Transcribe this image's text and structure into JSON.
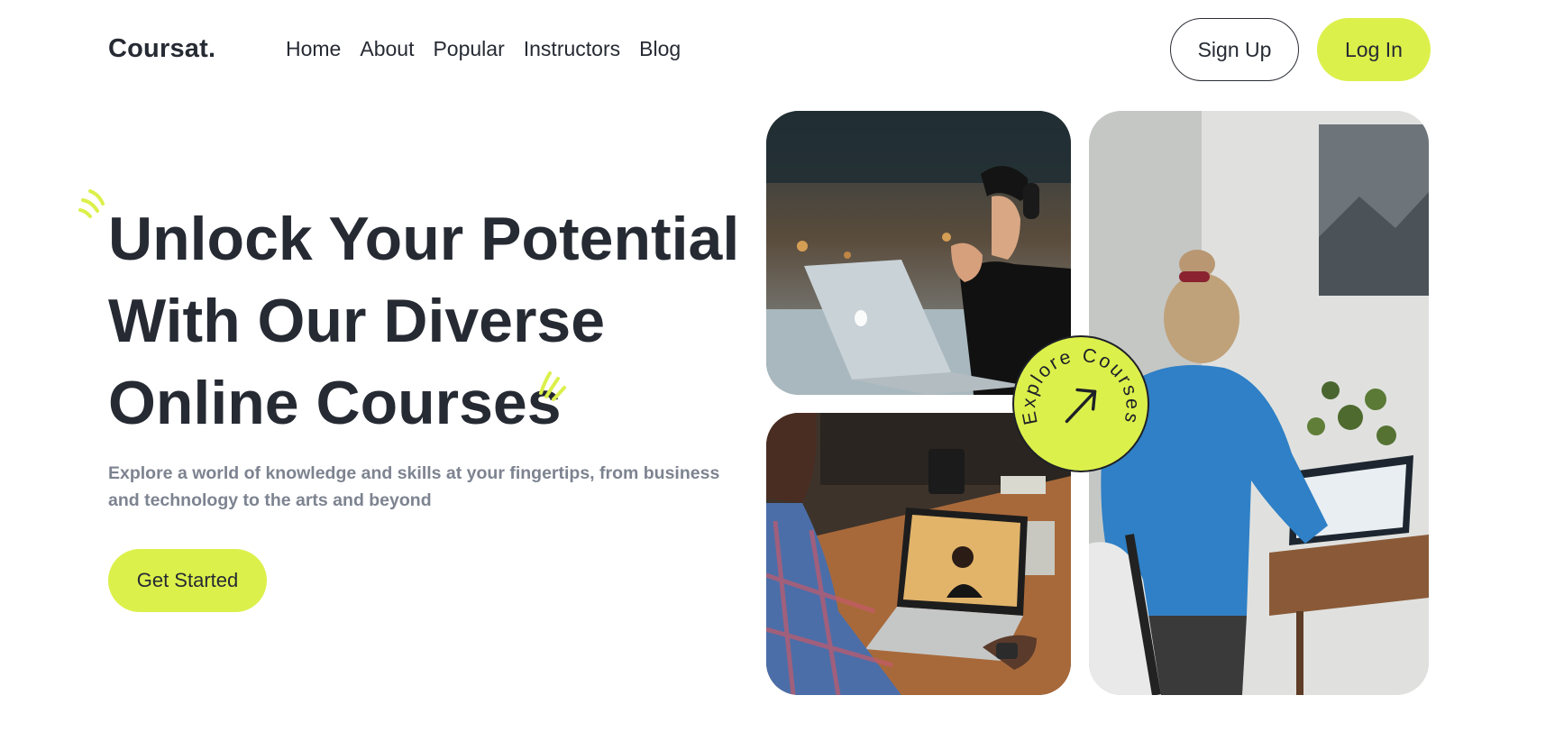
{
  "header": {
    "logo": "Coursat.",
    "nav": [
      "Home",
      "About",
      "Popular",
      "Instructors",
      "Blog"
    ],
    "signup_label": "Sign Up",
    "login_label": "Log In"
  },
  "hero": {
    "title_lines": [
      "Unlock Your Potential",
      "With Our Diverse",
      "Online Courses"
    ],
    "description": "Explore a world of knowledge and skills at your fingertips, from business and technology to the arts and beyond",
    "cta_label": "Get Started"
  },
  "badge": {
    "text": "Explore Courses",
    "icon": "arrow-up-right-icon"
  },
  "images": [
    {
      "name": "man-with-headphones-laptop-photo"
    },
    {
      "name": "video-call-laptop-photo"
    },
    {
      "name": "woman-blue-sweater-laptop-photo"
    }
  ],
  "colors": {
    "accent": "#dcf04b",
    "text": "#262a33",
    "muted": "#7d8390",
    "background": "#ffffff"
  }
}
